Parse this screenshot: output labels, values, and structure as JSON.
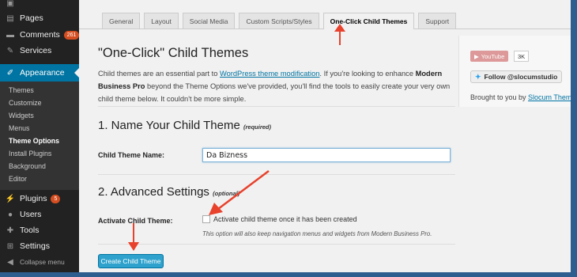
{
  "sidebar": {
    "top_items": [
      {
        "label": "Pages",
        "icon": "pages-icon"
      },
      {
        "label": "Comments",
        "icon": "comments-icon",
        "badge": "261"
      },
      {
        "label": "Services",
        "icon": "services-icon"
      }
    ],
    "active_item": {
      "label": "Appearance",
      "icon": "appearance-icon"
    },
    "submenu": [
      "Themes",
      "Customize",
      "Widgets",
      "Menus",
      "Theme Options",
      "Install Plugins",
      "Background",
      "Editor"
    ],
    "current_submenu": "Theme Options",
    "bottom_items": [
      {
        "label": "Plugins",
        "icon": "plugins-icon",
        "badge": "5"
      },
      {
        "label": "Users",
        "icon": "users-icon"
      },
      {
        "label": "Tools",
        "icon": "tools-icon"
      },
      {
        "label": "Settings",
        "icon": "settings-icon"
      },
      {
        "label": "Collapse menu",
        "icon": "collapse-icon"
      }
    ]
  },
  "tabs": [
    {
      "label": "General"
    },
    {
      "label": "Layout"
    },
    {
      "label": "Social Media"
    },
    {
      "label": "Custom Scripts/Styles"
    },
    {
      "label": "One-Click Child Themes",
      "active": true
    },
    {
      "label": "Support"
    }
  ],
  "page": {
    "title": "\"One-Click\" Child Themes",
    "intro_pre": "Child themes are an essential part to ",
    "intro_link": "WordPress theme modification",
    "intro_mid": ". If you're looking to enhance ",
    "intro_bold": "Modern Business Pro",
    "intro_post": " beyond the Theme Options we've provided, you'll find the tools to easily create your very own child theme below. It couldn't be more simple.",
    "section1_title": "1. Name Your Child Theme",
    "section1_tag": "(required)",
    "name_label": "Child Theme Name:",
    "name_value": "Da Bizness",
    "section2_title": "2. Advanced Settings",
    "section2_tag": "(optional)",
    "activate_label": "Activate Child Theme:",
    "activate_checkbox_label": "Activate child theme once it has been created",
    "activate_hint": "This option will also keep navigation menus and widgets from Modern Business Pro.",
    "create_button": "Create Child Theme"
  },
  "side_box": {
    "youtube_label": "YouTube",
    "youtube_count": "3K",
    "twitter_label": "Follow @slocumstudio",
    "brought_pre": "Brought to you by ",
    "brought_link": "Slocum Themes"
  },
  "colors": {
    "sidebar_bg": "#222222",
    "active_blue": "#0074a2",
    "button_blue": "#2ea2cc",
    "badge_orange": "#d54e21",
    "annotation_red": "#e8412c",
    "frame_border": "#2e5e8f"
  }
}
